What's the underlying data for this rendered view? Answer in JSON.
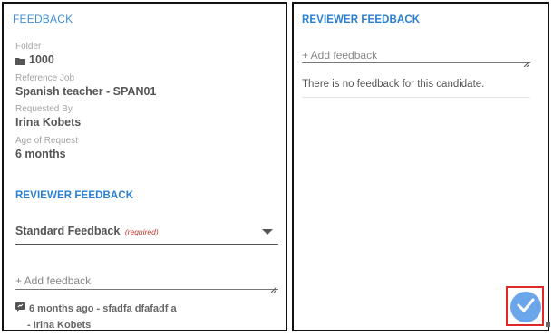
{
  "left_panel": {
    "header": "FEEDBACK",
    "folder": {
      "label": "Folder",
      "value": "1000",
      "icon": "folder-icon"
    },
    "reference_job": {
      "label": "Reference Job",
      "value": "Spanish teacher - SPAN01"
    },
    "requested_by": {
      "label": "Requested By",
      "value": "Irina Kobets"
    },
    "age_of_request": {
      "label": "Age of Request",
      "value": "6 months"
    },
    "reviewer_title": "REVIEWER FEEDBACK",
    "feedback_select": {
      "value": "Standard Feedback",
      "required_label": "(required)"
    },
    "feedback_input": {
      "placeholder": "+ Add feedback"
    },
    "comment": {
      "icon": "comment-flag-icon",
      "text": "6 months ago - sfadfa dfafadf a",
      "author": "- Irina Kobets"
    }
  },
  "right_panel": {
    "reviewer_title": "REVIEWER FEEDBACK",
    "feedback_input": {
      "placeholder": "+ Add feedback"
    },
    "empty_message": "There is no feedback for this candidate.",
    "submit_button": {
      "icon": "checkmark-icon"
    }
  },
  "colors": {
    "accent_blue": "#2b7fd0",
    "header_blue": "#3f8fd6",
    "fab_blue": "#6aa6e9",
    "highlight_red": "#e02828",
    "required_red": "#c0392b"
  }
}
